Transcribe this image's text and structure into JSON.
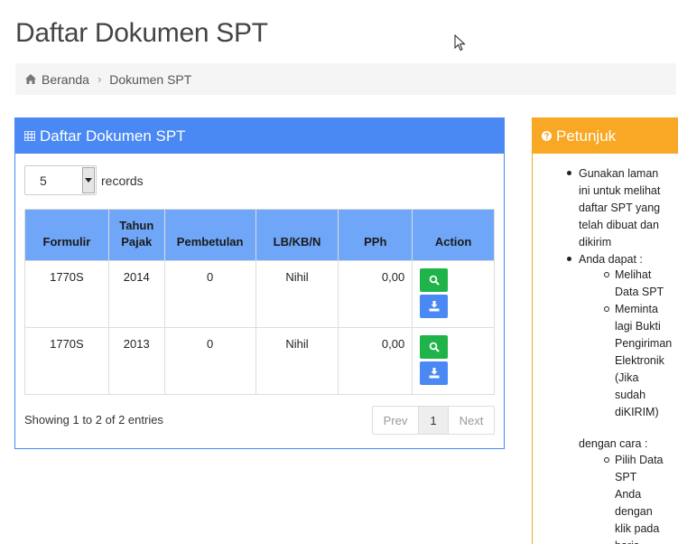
{
  "page": {
    "title": "Daftar Dokumen SPT"
  },
  "breadcrumb": {
    "home": "Beranda",
    "current": "Dokumen SPT"
  },
  "main_panel": {
    "heading": "Daftar Dokumen SPT",
    "records_value": "5",
    "records_label": "records",
    "columns": [
      "Formulir",
      "Tahun Pajak",
      "Pembetulan",
      "LB/KB/N",
      "PPh",
      "Action"
    ],
    "column_lines": {
      "tahun_1": "Tahun",
      "tahun_2": "Pajak"
    },
    "rows": [
      {
        "formulir": "1770S",
        "tahun": "2014",
        "pembetulan": "0",
        "status": "Nihil",
        "pph": "0,00"
      },
      {
        "formulir": "1770S",
        "tahun": "2013",
        "pembetulan": "0",
        "status": "Nihil",
        "pph": "0,00"
      }
    ],
    "showing": "Showing 1 to 2 of 2 entries",
    "pagination": {
      "prev": "Prev",
      "current": "1",
      "next": "Next"
    },
    "colors": {
      "heading_bg": "#4a89f3",
      "header_bg": "#6fa6f7",
      "view_btn": "#1fb34a",
      "download_btn": "#4a89f3"
    },
    "icons": {
      "view": "search-icon",
      "download": "download-icon"
    }
  },
  "side_panel": {
    "heading": "Petunjuk",
    "bg_color": "#f9a825",
    "lines": {
      "l1": "Gunakan laman",
      "l2": "ini untuk melihat",
      "l3": "daftar SPT yang",
      "l4": "telah dibuat dan",
      "l5": "dikirim",
      "l6": "Anda dapat :",
      "l7": "Melihat",
      "l8": "Data SPT",
      "l9": "Meminta",
      "l10": "lagi Bukti",
      "l11": "Pengiriman",
      "l12": "Elektronik",
      "l13": "(Jika",
      "l14": "sudah",
      "l15": "diKIRIM)",
      "l16": "dengan cara :",
      "l17": "Pilih Data",
      "l18": "SPT",
      "l19": "Anda",
      "l20": "dengan",
      "l21": "klik pada",
      "l22": "baris"
    }
  }
}
